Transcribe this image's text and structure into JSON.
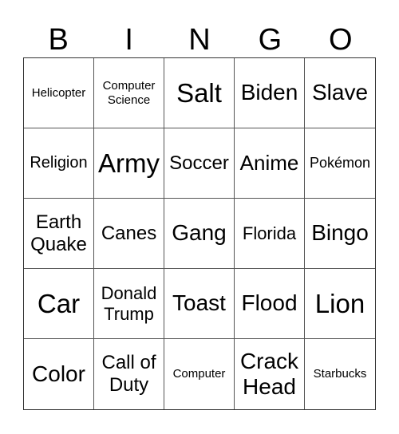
{
  "header": [
    "B",
    "I",
    "N",
    "G",
    "O"
  ],
  "cells": [
    [
      "Helicopter",
      "Computer Science",
      "Salt",
      "Biden",
      "Slave"
    ],
    [
      "Religion",
      "Army",
      "Soccer",
      "Anime",
      "Pokémon"
    ],
    [
      "Earth Quake",
      "Canes",
      "Gang",
      "Florida",
      "Bingo"
    ],
    [
      "Car",
      "Donald Trump",
      "Toast",
      "Flood",
      "Lion"
    ],
    [
      "Color",
      "Call of Duty",
      "Computer",
      "Crack Head",
      "Starbucks"
    ]
  ]
}
